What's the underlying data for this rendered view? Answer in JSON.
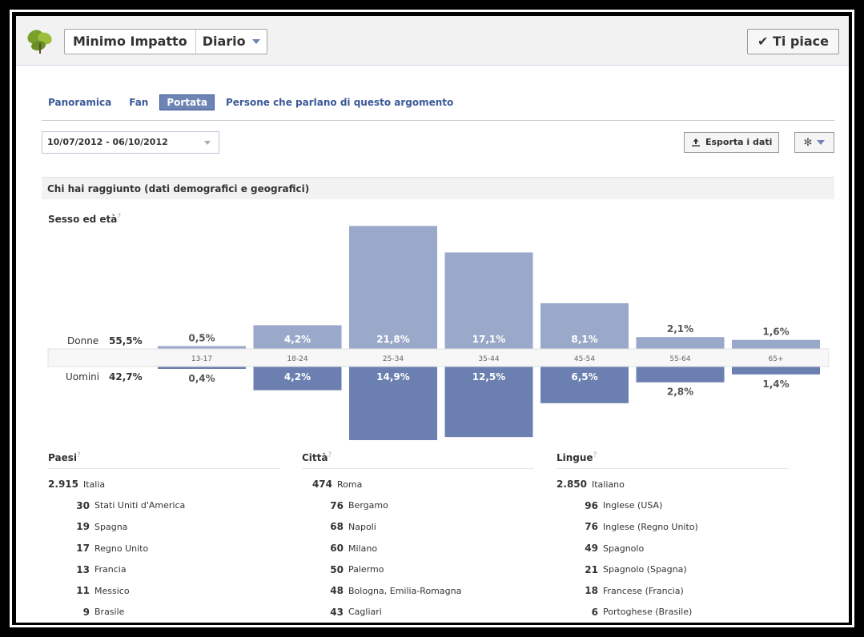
{
  "header": {
    "page_name": "Minimo Impatto",
    "timeline_label": "Diario",
    "like_label": "✔ Ti piace",
    "logo_icon": "leaf-logo-icon"
  },
  "tabs": [
    {
      "label": "Panoramica",
      "active": false
    },
    {
      "label": "Fan",
      "active": false
    },
    {
      "label": "Portata",
      "active": true
    },
    {
      "label": "Persone che parlano di questo argomento",
      "active": false
    }
  ],
  "controls": {
    "date_range": "10/07/2012 - 06/10/2012",
    "export_label": "Esporta i dati",
    "export_icon": "upload-icon",
    "settings_icon": "gear-icon"
  },
  "section": {
    "title": "Chi hai raggiunto (dati demografici e geografici)",
    "subtitle": "Sesso ed età",
    "help_mark": "?"
  },
  "chart_data": {
    "type": "bar",
    "categories": [
      "13-17",
      "18-24",
      "25-34",
      "35-44",
      "45-54",
      "55-64",
      "65+"
    ],
    "series": [
      {
        "name": "Donne",
        "total": "55,5%",
        "values": [
          0.5,
          4.2,
          21.8,
          17.1,
          8.1,
          2.1,
          1.6
        ],
        "labels": [
          "0,5%",
          "4,2%",
          "21,8%",
          "17,1%",
          "8,1%",
          "2,1%",
          "1,6%"
        ],
        "color": "#9aa9c9"
      },
      {
        "name": "Uomini",
        "total": "42,7%",
        "values": [
          0.4,
          4.2,
          14.9,
          12.5,
          6.5,
          2.8,
          1.4
        ],
        "labels": [
          "0,4%",
          "4,2%",
          "14,9%",
          "12,5%",
          "6,5%",
          "2,8%",
          "1,4%"
        ],
        "color": "#6b80b0"
      }
    ],
    "colors": {
      "women": "#9aa9c9",
      "men": "#6b80b0",
      "band": "#f7f7f7"
    }
  },
  "lists": {
    "countries": {
      "title": "Paesi",
      "items": [
        {
          "value": "2.915",
          "label": "Italia"
        },
        {
          "value": "30",
          "label": "Stati Uniti d'America"
        },
        {
          "value": "19",
          "label": "Spagna"
        },
        {
          "value": "17",
          "label": "Regno Unito"
        },
        {
          "value": "13",
          "label": "Francia"
        },
        {
          "value": "11",
          "label": "Messico"
        },
        {
          "value": "9",
          "label": "Brasile"
        }
      ]
    },
    "cities": {
      "title": "Città",
      "items": [
        {
          "value": "474",
          "label": "Roma"
        },
        {
          "value": "76",
          "label": "Bergamo"
        },
        {
          "value": "68",
          "label": "Napoli"
        },
        {
          "value": "60",
          "label": "Milano"
        },
        {
          "value": "50",
          "label": "Palermo"
        },
        {
          "value": "48",
          "label": "Bologna, Emilia-Romagna"
        },
        {
          "value": "43",
          "label": "Cagliari"
        }
      ]
    },
    "languages": {
      "title": "Lingue",
      "items": [
        {
          "value": "2.850",
          "label": "Italiano"
        },
        {
          "value": "96",
          "label": "Inglese (USA)"
        },
        {
          "value": "76",
          "label": "Inglese (Regno Unito)"
        },
        {
          "value": "49",
          "label": "Spagnolo"
        },
        {
          "value": "21",
          "label": "Spagnolo (Spagna)"
        },
        {
          "value": "18",
          "label": "Francese (Francia)"
        },
        {
          "value": "6",
          "label": "Portoghese (Brasile)"
        }
      ]
    }
  }
}
